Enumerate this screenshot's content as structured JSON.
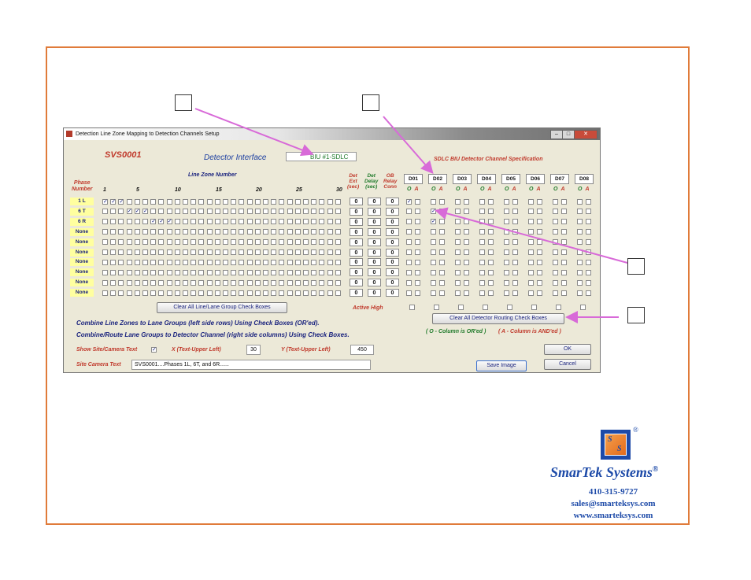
{
  "window": {
    "title": "Detection Line Zone Mapping to Detection Channels Setup"
  },
  "header": {
    "site_code": "SVS0001",
    "detector_interface_label": "Detector Interface",
    "biu_value": "BIU #1-SDLC",
    "sdlc_spec_label": "SDLC BIU Detector Channel Specification"
  },
  "grid": {
    "line_zone_number_label": "Line Zone Number",
    "phase_header": [
      "Phase",
      "Number"
    ],
    "column_numbers": [
      "1",
      "5",
      "10",
      "15",
      "20",
      "25",
      "30"
    ],
    "det_ext_header": [
      "Det",
      "Ext",
      "(sec)"
    ],
    "det_delay_header": [
      "Det",
      "Delay",
      "(sec)"
    ],
    "ob_relay_header": [
      "OB",
      "Relay",
      "Conn"
    ],
    "detector_channels": [
      "D01",
      "D02",
      "D03",
      "D04",
      "D05",
      "D06",
      "D07",
      "D08"
    ],
    "oa_labels": {
      "o": "O",
      "a": "A"
    },
    "rows": [
      {
        "phase": "1 L",
        "zones": [
          1,
          2,
          3
        ],
        "ext": "0",
        "delay": "0",
        "relay": "0",
        "routes": [
          [
            0,
            0
          ]
        ]
      },
      {
        "phase": "6 T",
        "zones": [
          4,
          5,
          6
        ],
        "ext": "0",
        "delay": "0",
        "relay": "0",
        "routes": [
          [
            1,
            0
          ]
        ]
      },
      {
        "phase": "6 R",
        "zones": [
          7,
          8,
          9
        ],
        "ext": "0",
        "delay": "0",
        "relay": "0",
        "routes": [
          [
            1,
            0
          ]
        ]
      },
      {
        "phase": "None",
        "zones": [],
        "ext": "0",
        "delay": "0",
        "relay": "0",
        "routes": []
      },
      {
        "phase": "None",
        "zones": [],
        "ext": "0",
        "delay": "0",
        "relay": "0",
        "routes": []
      },
      {
        "phase": "None",
        "zones": [],
        "ext": "0",
        "delay": "0",
        "relay": "0",
        "routes": []
      },
      {
        "phase": "None",
        "zones": [],
        "ext": "0",
        "delay": "0",
        "relay": "0",
        "routes": []
      },
      {
        "phase": "None",
        "zones": [],
        "ext": "0",
        "delay": "0",
        "relay": "0",
        "routes": []
      },
      {
        "phase": "None",
        "zones": [],
        "ext": "0",
        "delay": "0",
        "relay": "0",
        "routes": []
      },
      {
        "phase": "None",
        "zones": [],
        "ext": "0",
        "delay": "0",
        "relay": "0",
        "routes": []
      }
    ]
  },
  "controls": {
    "clear_line_btn": "Clear All Line/Lane Group Check Boxes",
    "active_high_label": "Active High",
    "clear_detector_btn": "Clear All Detector Routing Check Boxes",
    "note_1": "Combine Line Zones to Lane Groups (left side rows) Using Check Boxes (OR'ed).",
    "note_2": "Combine/Route Lane Groups to Detector Channel (right side columns) Using Check Boxes.",
    "legend_o": "( O - Column is OR'ed )",
    "legend_a": "( A - Column is AND'ed )",
    "show_site_label": "Show Site/Camera Text",
    "show_site_checked": "✓",
    "x_label": "X (Text-Upper Left)",
    "x_value": "30",
    "y_label": "Y (Text-Upper Left)",
    "y_value": "450",
    "site_camera_label": "Site Camera Text",
    "site_camera_value": "SVS0001....Phases 1L, 6T, and 6R......",
    "ok_btn": "OK",
    "save_image_btn": "Save Image",
    "cancel_btn": "Cancel"
  },
  "branding": {
    "logo_letter_top": "S",
    "logo_letter_bottom": "S",
    "registered": "®",
    "company": "SmarTek Systems",
    "phone": "410-315-9727",
    "email": "sales@smarteksys.com",
    "website": "www.smarteksys.com"
  },
  "colors": {
    "frame_border": "#e07b3a",
    "callout_arrow": "#d86ad8",
    "brand_blue": "#1d4aa8"
  }
}
